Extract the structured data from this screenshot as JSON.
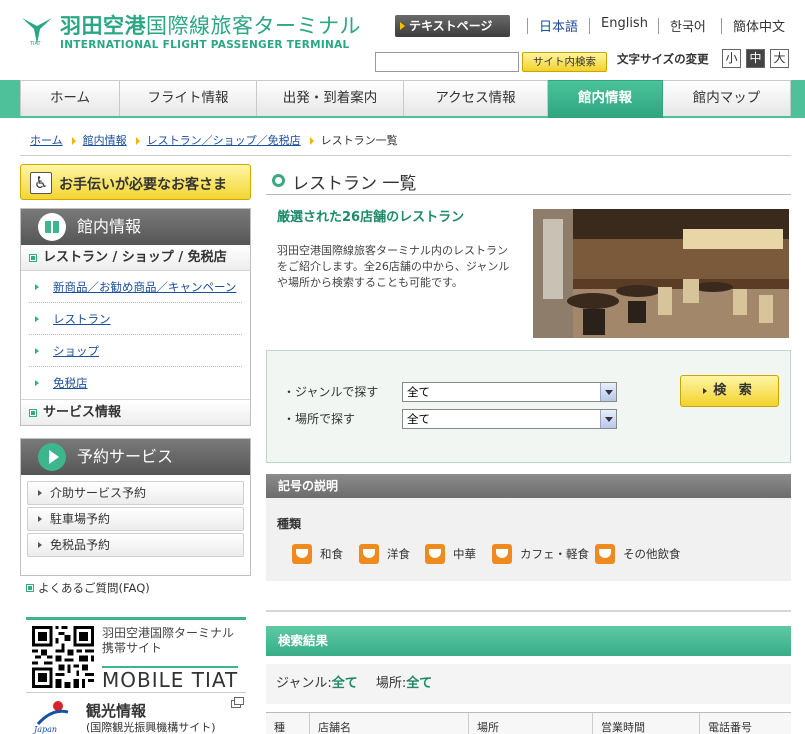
{
  "header": {
    "logo_jp_bold": "羽田空港",
    "logo_jp_light": "国際線旅客ターミナル",
    "logo_en": "INTERNATIONAL FLIGHT PASSENGER TERMINAL",
    "text_page_label": "テキストページ",
    "languages": [
      "日本語",
      "English",
      "한국어",
      "簡体中文"
    ],
    "search_placeholder": "",
    "search_button": "サイト内検索",
    "font_size_label": "文字サイズの変更",
    "font_sizes": [
      "小",
      "中",
      "大"
    ]
  },
  "nav": {
    "items": [
      "ホーム",
      "フライト情報",
      "出発・到着案内",
      "アクセス情報",
      "館内情報",
      "館内マップ"
    ],
    "active_index": 4
  },
  "breadcrumb": {
    "items": [
      "ホーム",
      "館内情報",
      "レストラン／ショップ／免税店"
    ],
    "current": "レストラン一覧"
  },
  "sidebar": {
    "help_label": "お手伝いが必要なお客さま",
    "info_title": "館内情報",
    "info_section": "レストラン / ショップ / 免税店",
    "info_links": [
      "新商品／お勧め商品／キャンペーン",
      "レストラン",
      "ショップ",
      "免税店"
    ],
    "service_section": "サービス情報",
    "reservation_title": "予約サービス",
    "reservation_items": [
      "介助サービス予約",
      "駐車場予約",
      "免税品予約"
    ],
    "faq_label": "よくあるご質問(FAQ)",
    "mobile_text": "羽田空港国際ターミナル携帯サイト",
    "mobile_brand": "MOBILE TIAT",
    "tour_title": "観光情報",
    "tour_sub": "(国際観光振興機構サイト)"
  },
  "main": {
    "title": "レストラン 一覧",
    "intro_heading": "厳選された26店舗のレストラン",
    "intro_text": "羽田空港国際線旅客ターミナル内のレストランをご紹介します。全26店舗の中から、ジャンルや場所から検索することも可能です。",
    "filter": {
      "genre_label": "ジャンルで探す",
      "genre_value": "全て",
      "place_label": "場所で探す",
      "place_value": "全て",
      "submit_label": "検 索"
    },
    "legend": {
      "title": "記号の説明",
      "subtitle": "種類",
      "items": [
        "和食",
        "洋食",
        "中華",
        "カフェ・軽食",
        "その他飲食"
      ]
    },
    "results": {
      "title": "検索結果",
      "genre_label": "ジャンル:",
      "genre_value": "全て",
      "place_label": "場所:",
      "place_value": "全て",
      "columns": [
        "種",
        "店舗名",
        "場所",
        "営業時間",
        "電話番号"
      ]
    }
  },
  "colors": {
    "brand_green": "#2aa784",
    "nav_green": "#4fc19a",
    "accent_yellow": "#f2d22a",
    "link_blue": "#1a4f9c",
    "legend_orange": "#ef8a1e"
  }
}
